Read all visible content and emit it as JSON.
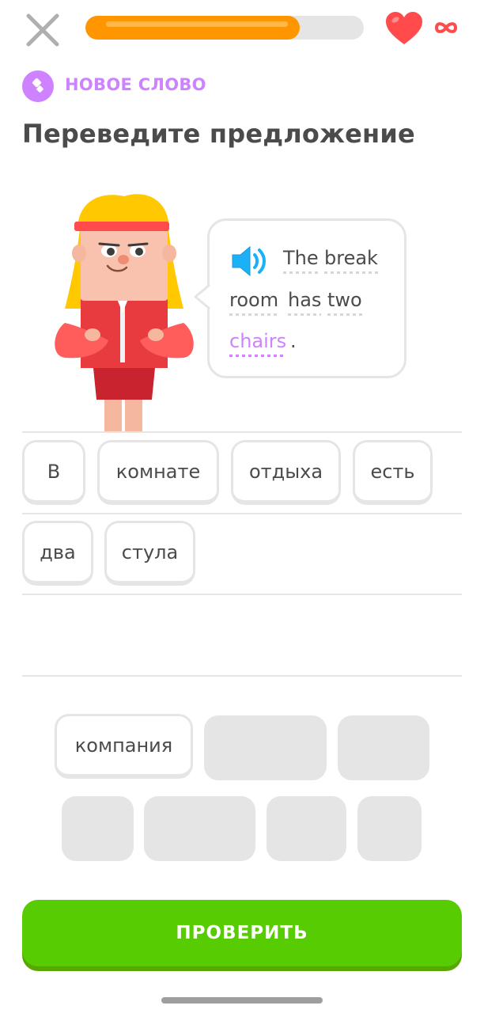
{
  "progress": {
    "percent": 77
  },
  "hearts": {
    "count_label": "infinite"
  },
  "header": {
    "badge_label": "НОВОЕ СЛОВО",
    "title": "Переведите предложение"
  },
  "prompt": {
    "words": [
      "The",
      "break",
      "room",
      "has",
      "two",
      "chairs"
    ],
    "new_word": "chairs",
    "punctuation": "."
  },
  "answer": {
    "selected_words": [
      "В",
      "комнате",
      "отдыха",
      "есть",
      "два",
      "стула"
    ]
  },
  "word_bank": {
    "available": [
      "компания"
    ],
    "used_slots": 6
  },
  "check_button": {
    "label": "ПРОВЕРИТЬ"
  },
  "colors": {
    "accent_purple": "#ce82ff",
    "progress_orange": "#ff9600",
    "heart_red": "#ff4b4b",
    "button_green": "#58cc02",
    "tile_border": "#e5e5e5"
  },
  "icons": [
    "close-icon",
    "heart-icon",
    "infinity-icon",
    "new-word-icon",
    "speaker-icon"
  ]
}
